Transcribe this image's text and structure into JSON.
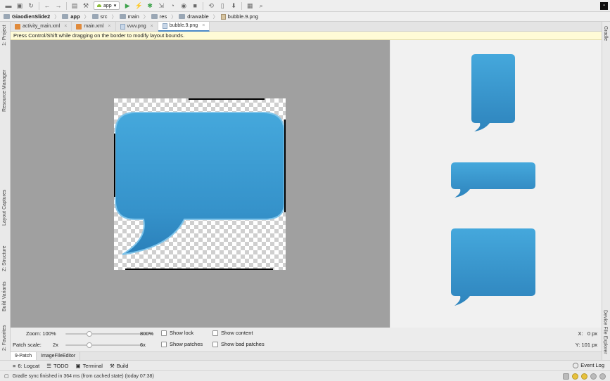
{
  "toolbar": {
    "run_config": "app"
  },
  "breadcrumb": [
    "GiaodienSlide2",
    "app",
    "src",
    "main",
    "res",
    "drawable",
    "bubble.9.png"
  ],
  "tabs": [
    {
      "label": "activity_main.xml",
      "type": "xml",
      "active": false
    },
    {
      "label": "main.xml",
      "type": "xml",
      "active": false
    },
    {
      "label": "vvvv.png",
      "type": "png",
      "active": false
    },
    {
      "label": "bubble.9.png",
      "type": "png",
      "active": true
    }
  ],
  "notice": "Press Control/Shift while dragging on the border to modify layout bounds.",
  "left_sidebar": {
    "project": "1: Project",
    "resource_manager": "Resource Manager",
    "layout_captures": "Layout Captures",
    "structure": "Z: Structure",
    "build_variants": "Build Variants",
    "favorites": "2: Favorites"
  },
  "right_sidebar": {
    "gradle": "Gradle",
    "device_file_explorer": "Device File Explorer"
  },
  "controls": {
    "zoom_label": "Zoom: 100%",
    "zoom_max": "800%",
    "zoom_level": 0.0,
    "patch_scale_label": "Patch scale:",
    "patch_scale_value": "2x",
    "patch_scale_max": "6x",
    "patch_scale_level": 0.0,
    "show_lock": "Show lock",
    "show_content": "Show content",
    "show_patches": "Show patches",
    "show_bad_patches": "Show bad patches",
    "x_readout": "X:   0 px",
    "y_readout": "Y: 101 px"
  },
  "editor_tabs": [
    {
      "label": "9-Patch",
      "active": true
    },
    {
      "label": "ImageFileEditor",
      "active": false
    }
  ],
  "tool_windows": {
    "logcat": "6: Logcat",
    "todo": "TODO",
    "terminal": "Terminal",
    "build": "Build",
    "event_log": "Event Log"
  },
  "status": "Gradle sync finished in 364 ms (from cached state) (today 07:38)",
  "colors": {
    "bubble": "#3a9bd4",
    "notice_bg": "#fffbd6"
  }
}
